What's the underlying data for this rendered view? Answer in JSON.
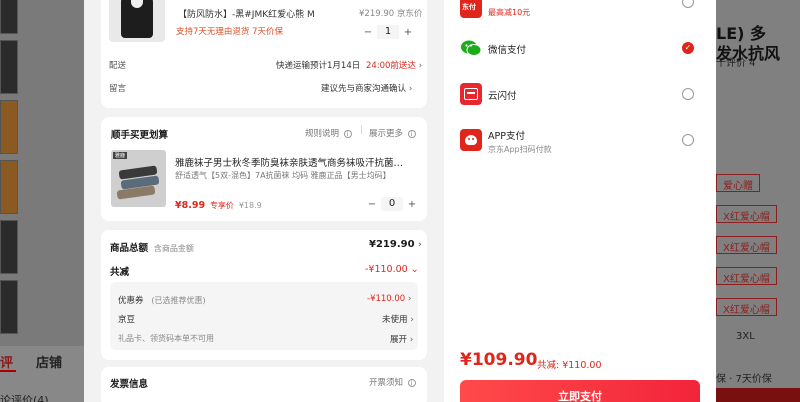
{
  "background": {
    "tabs": [
      "评",
      "店铺"
    ],
    "left_bottom": "论评价(4)",
    "right_title_line1": "LE) 多",
    "right_title_line2": "发水抗风",
    "right_reviews": "千评价 4",
    "right_tags": [
      "爱心赠",
      "X红爱心帽",
      "X红爱心帽",
      "X红爱心帽",
      "X红爱心帽"
    ],
    "right_size": "3XL",
    "right_footer": "保 · 7天价保"
  },
  "product": {
    "title": "【防风防水】-黑#JMK红爱心熊  M",
    "price": "¥219.90 京东价",
    "service": "支持7天无理由退货   7天价保",
    "quantity": "1",
    "minus": "−",
    "plus": "+"
  },
  "delivery": {
    "label": "配送",
    "value": "快递运输预计1月14日",
    "highlight": "24:00前送达",
    "chevron": "›"
  },
  "message": {
    "label": "留言",
    "value": "建议先与商家沟通确认",
    "chevron": "›"
  },
  "addon": {
    "heading": "顺手买更划算",
    "rules": "规则说明",
    "expand": "展示更多",
    "item_title": "雅鹿袜子男士秋冬季防臭袜亲肤透气商务袜吸汗抗菌…",
    "item_desc": "舒适透气【5双-混色】7A抗菌袜 均码 雅鹿正品【男士均码】",
    "item_price": "¥8.99",
    "item_price_tag": "专享价",
    "item_orig": "¥18.9",
    "item_qty": "0",
    "badge": "雅鹿"
  },
  "totals": {
    "goods_label": "商品总额",
    "goods_sub": "含商品金额",
    "goods_value": "¥219.90",
    "discount_label": "共减",
    "discount_value": "-¥110.00",
    "coupon_label": "优惠券",
    "coupon_sub": "(已选推荐优惠)",
    "coupon_value": "-¥110.00",
    "jingdou_label": "京豆",
    "jingdou_value": "未使用",
    "gift_label": "礼品卡、领货码本单不可用",
    "gift_value": "展开"
  },
  "invoice": {
    "label": "发票信息",
    "hint": "开票须知"
  },
  "payment": {
    "methods": [
      {
        "name": "东付",
        "sub": "最高减10元",
        "checked": false
      },
      {
        "name": "微信支付",
        "sub": "",
        "checked": true
      },
      {
        "name": "云闪付",
        "sub": "",
        "checked": false
      },
      {
        "name": "APP支付",
        "sub": "京东App扫码付款",
        "checked": false
      }
    ],
    "total": "¥109.90",
    "saved": "共减: ¥110.00",
    "pay_button": "立即支付",
    "check_mark": "✓"
  },
  "colors": {
    "accent_red": "#e1251b",
    "wechat_green": "#1aad19",
    "orange": "#e2502a"
  }
}
